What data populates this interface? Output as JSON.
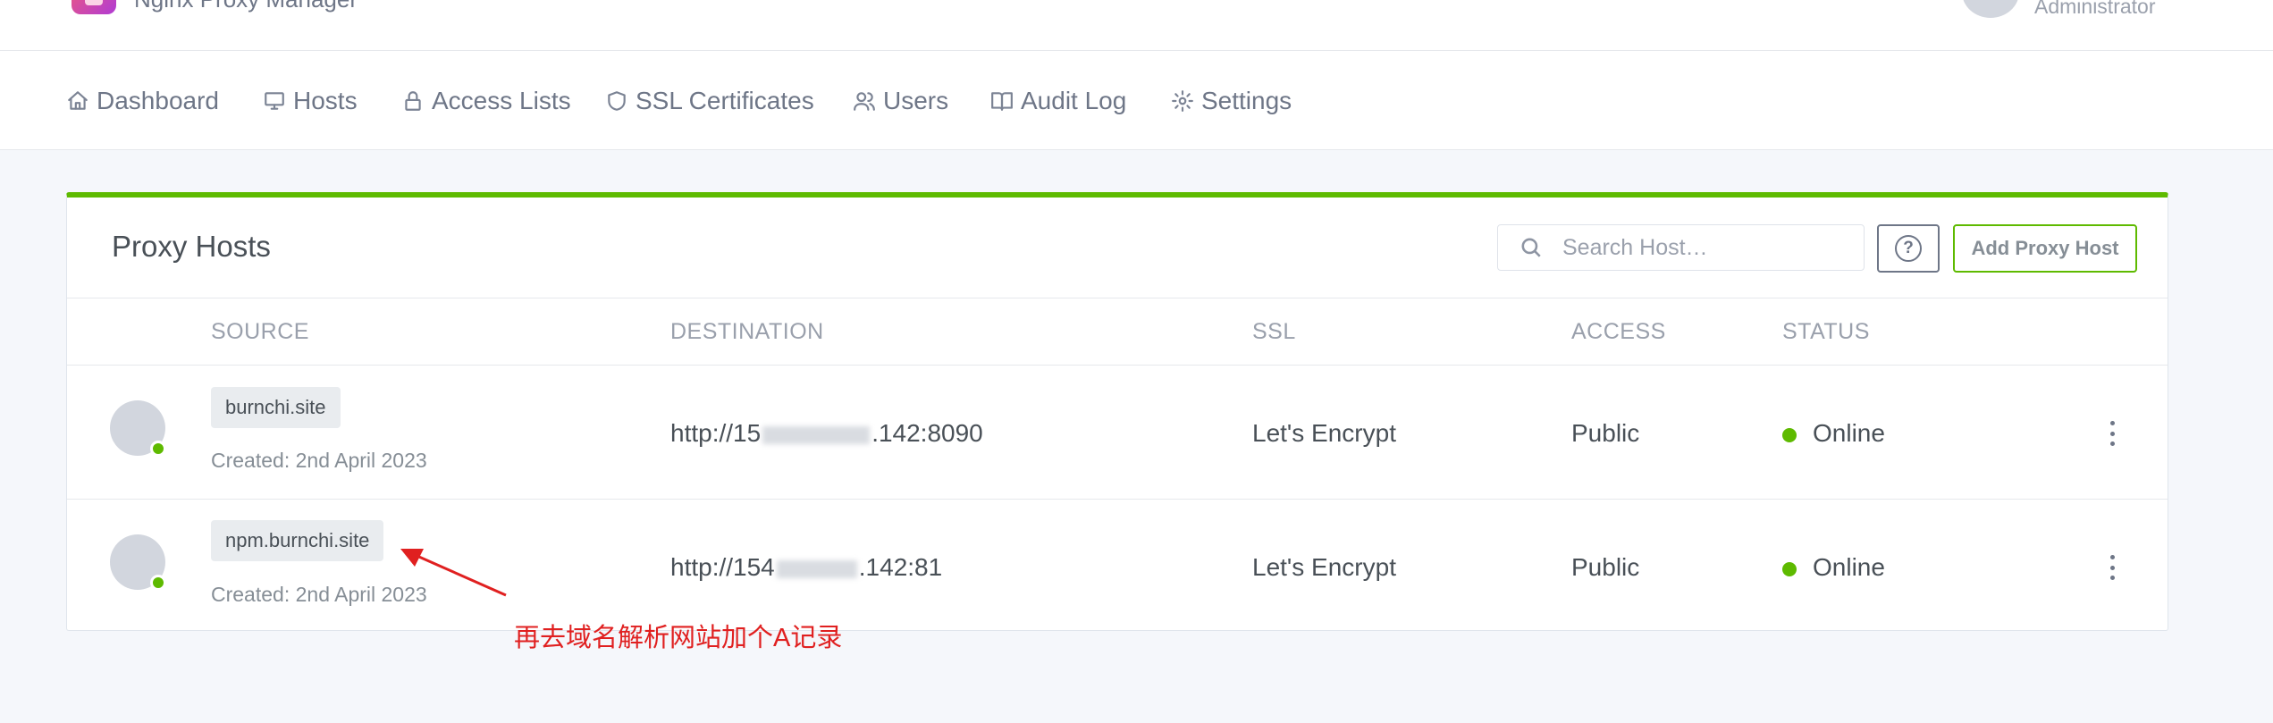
{
  "header": {
    "app_title": "Nginx Proxy Manager",
    "user_role": "Administrator"
  },
  "nav": {
    "items": [
      {
        "label": "Dashboard"
      },
      {
        "label": "Hosts"
      },
      {
        "label": "Access Lists"
      },
      {
        "label": "SSL Certificates"
      },
      {
        "label": "Users"
      },
      {
        "label": "Audit Log"
      },
      {
        "label": "Settings"
      }
    ]
  },
  "card": {
    "title": "Proxy Hosts",
    "search_placeholder": "Search Host…",
    "add_button": "Add Proxy Host",
    "accent_color": "#5eba00",
    "columns": [
      "SOURCE",
      "DESTINATION",
      "SSL",
      "ACCESS",
      "STATUS"
    ]
  },
  "rows": [
    {
      "domain": "burnchi.site",
      "created": "Created: 2nd April 2023",
      "destination_prefix": "http://15",
      "destination_suffix": ".142:8090",
      "ssl": "Let's Encrypt",
      "access": "Public",
      "status": "Online"
    },
    {
      "domain": "npm.burnchi.site",
      "created": "Created: 2nd April 2023",
      "destination_prefix": "http://154",
      "destination_suffix": ".142:81",
      "ssl": "Let's Encrypt",
      "access": "Public",
      "status": "Online"
    }
  ],
  "annotation": {
    "text": "再去域名解析网站加个A记录",
    "color": "#e02020"
  }
}
